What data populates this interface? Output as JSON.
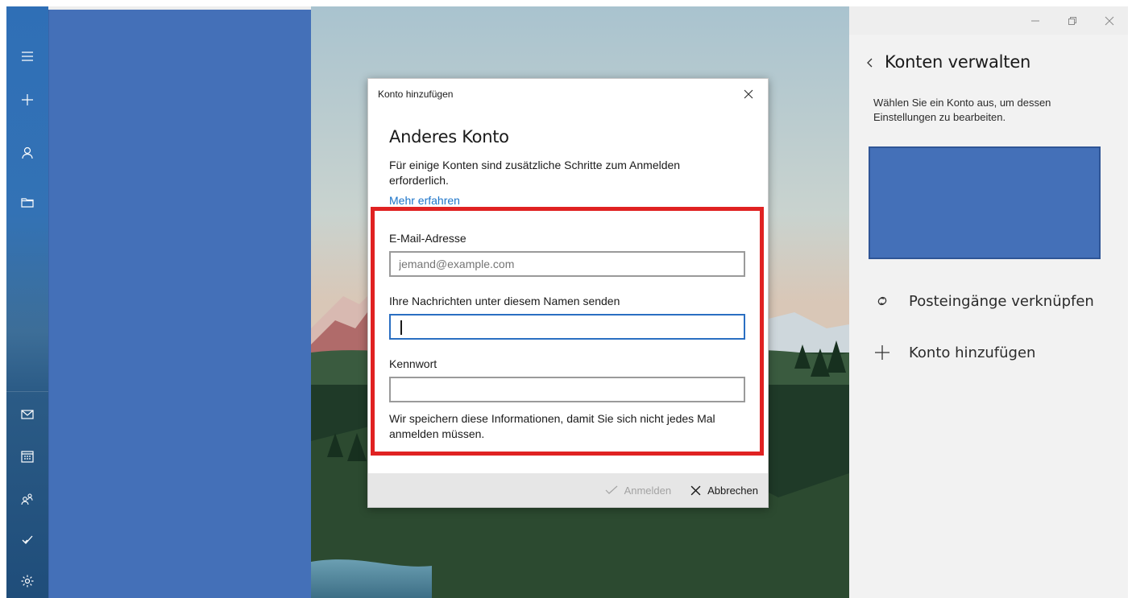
{
  "rail": {
    "top_icons": [
      "hamburger-menu-icon",
      "new-mail-plus-icon",
      "account-person-icon",
      "folder-icon"
    ],
    "bottom_icons": [
      "mail-icon",
      "calendar-icon",
      "people-icon",
      "todo-check-icon",
      "settings-gear-icon"
    ]
  },
  "window": {
    "controls": [
      "minimize-icon",
      "restore-icon",
      "close-icon"
    ]
  },
  "right_pane": {
    "title": "Konten verwalten",
    "description": "Wählen Sie ein Konto aus, um dessen Einstellungen zu bearbeiten.",
    "link_inboxes_label": "Posteingänge verknüpfen",
    "add_account_label": "Konto hinzufügen"
  },
  "dialog": {
    "caption": "Konto hinzufügen",
    "heading": "Anderes Konto",
    "description": "Für einige Konten sind zusätzliche Schritte zum Anmelden erforderlich.",
    "learn_more": "Mehr erfahren",
    "email_label": "E-Mail-Adresse",
    "email_placeholder": "jemand@example.com",
    "email_value": "",
    "name_label": "Ihre Nachrichten unter diesem Namen senden",
    "name_value": "",
    "password_label": "Kennwort",
    "password_value": "",
    "note": "Wir speichern diese Informationen, damit Sie sich nicht jedes Mal anmelden müssen.",
    "sign_in_label": "Anmelden",
    "cancel_label": "Abbrechen"
  },
  "colors": {
    "highlight_border": "#e02222",
    "accent": "#1c74c9",
    "redacted_block": "#4470b8"
  }
}
